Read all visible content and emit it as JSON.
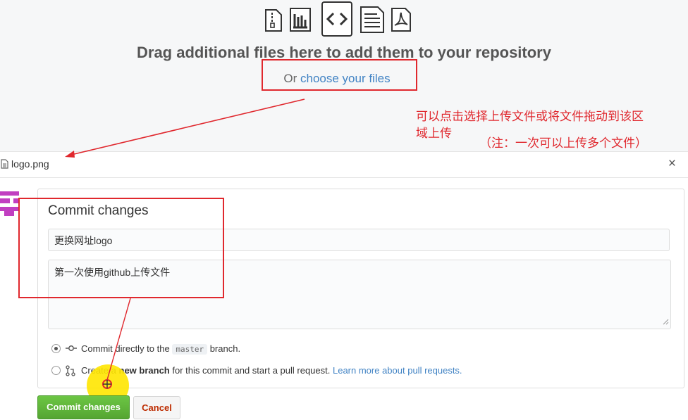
{
  "dropzone": {
    "icons": [
      "zip-file-icon",
      "chart-file-icon",
      "code-file-icon",
      "text-file-icon",
      "pdf-file-icon"
    ],
    "title": "Drag additional files here to add them to your repository",
    "choose_prefix": "Or",
    "choose_link": "choose your files"
  },
  "annotations": {
    "note_line1": "可以点击选择上传文件或将文件拖动到该区",
    "note_line2": "域上传",
    "note_line3": "（注：一次可以上传多个文件）",
    "color": "#e0282e"
  },
  "file": {
    "name": "logo.png",
    "close_label": "×"
  },
  "commit": {
    "title": "Commit changes",
    "summary_value": "更换网址logo",
    "description_value": "第一次使用github上传文件",
    "option_direct_prefix": "Commit directly to the",
    "branch_name": "master",
    "option_direct_suffix": "branch.",
    "option_new_prefix": "Create a",
    "option_new_bold": "new branch",
    "option_new_suffix": "for this commit and start a pull request.",
    "learn_more": "Learn more about pull requests.",
    "commit_button": "Commit changes",
    "cancel_button": "Cancel"
  },
  "colors": {
    "accent_green": "#55a532",
    "link_blue": "#4183c4",
    "cancel_red": "#bd2c00"
  }
}
